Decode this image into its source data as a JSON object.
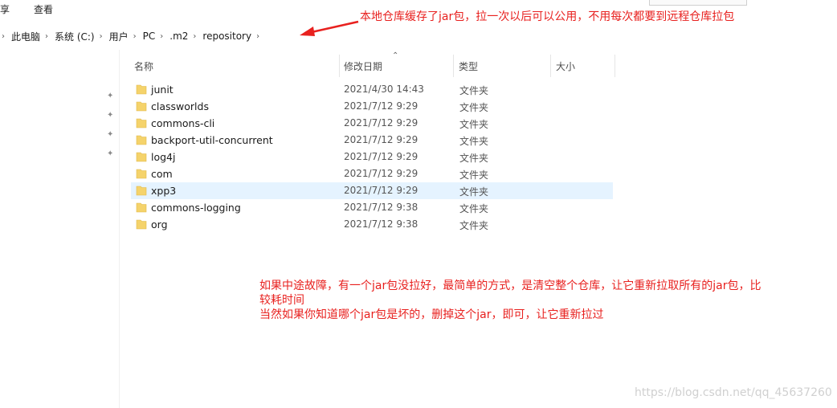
{
  "ribbon": {
    "share_tab": "享",
    "view_tab": "查看"
  },
  "address": {
    "crumbs": [
      "此电脑",
      "系统 (C:)",
      "用户",
      "PC",
      ".m2",
      "repository"
    ]
  },
  "columns": {
    "name": "名称",
    "date": "修改日期",
    "type": "类型",
    "size": "大小"
  },
  "files": [
    {
      "name": "junit",
      "date": "2021/4/30 14:43",
      "type": "文件夹"
    },
    {
      "name": "classworlds",
      "date": "2021/7/12 9:29",
      "type": "文件夹"
    },
    {
      "name": "commons-cli",
      "date": "2021/7/12 9:29",
      "type": "文件夹"
    },
    {
      "name": "backport-util-concurrent",
      "date": "2021/7/12 9:29",
      "type": "文件夹"
    },
    {
      "name": "log4j",
      "date": "2021/7/12 9:29",
      "type": "文件夹"
    },
    {
      "name": "com",
      "date": "2021/7/12 9:29",
      "type": "文件夹"
    },
    {
      "name": "xpp3",
      "date": "2021/7/12 9:29",
      "type": "文件夹"
    },
    {
      "name": "commons-logging",
      "date": "2021/7/12 9:38",
      "type": "文件夹"
    },
    {
      "name": "org",
      "date": "2021/7/12 9:38",
      "type": "文件夹"
    }
  ],
  "annotations": {
    "top_note": "本地仓库缓存了jar包，拉一次以后可以公用，不用每次都要到远程仓库拉包",
    "bottom_note_line1": "如果中途故障，有一个jar包没拉好，最简单的方式，是清空整个仓库，让它重新拉取所有的jar包，比",
    "bottom_note_line2": "较耗时间",
    "bottom_note_line3": "当然如果你知道哪个jar包是坏的，删掉这个jar，即可，让它重新拉过"
  },
  "watermark": "https://blog.csdn.net/qq_45637260",
  "colors": {
    "annotation": "#e8211f",
    "selected_row": "#e5f3ff",
    "folder": "#f5d36b"
  }
}
